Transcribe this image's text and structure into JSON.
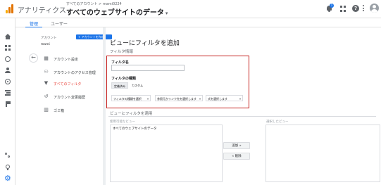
{
  "header": {
    "product": "アナリティクス",
    "breadcrumb": "すべてのアカウント > mami0224",
    "view_title": "すべてのウェブサイトのデータ",
    "notification_count": "1"
  },
  "admin_tabs": [
    {
      "label": "管理"
    },
    {
      "label": "ユーザー"
    }
  ],
  "account_column": {
    "label": "アカウント",
    "create_button": "+ アカウントを作成",
    "account_name": "mami",
    "menu": [
      {
        "label": "アカウント設定",
        "icon": "building-icon"
      },
      {
        "label": "アカウントのアクセス管理",
        "icon": "people-icon"
      },
      {
        "label": "すべてのフィルタ",
        "icon": "filter-icon",
        "active": true
      },
      {
        "label": "アカウント変更履歴",
        "icon": "history-icon"
      },
      {
        "label": "ゴミ箱",
        "icon": "trash-icon"
      }
    ]
  },
  "main": {
    "title": "ビューにフィルタを追加",
    "filter_info_heading": "フィルタ情報",
    "filter_name_label": "フィルタ名",
    "filter_name_value": "",
    "filter_type_label": "フィルタの種類",
    "type_buttons": [
      {
        "label": "定義済み"
      },
      {
        "label": "カスタム"
      }
    ],
    "selects": [
      {
        "label": "フィルタの種類を選択"
      },
      {
        "label": "参照元かリンク先を選択します"
      },
      {
        "label": "式を選択します"
      }
    ],
    "apply_heading": "ビューにフィルタを適用",
    "available_views_label": "使用可能なビュー",
    "selected_views_label": "選択したビュー",
    "available_views": [
      "すべてのウェブサイトのデータ"
    ],
    "add_button": "追加 »",
    "remove_button": "« 削除"
  },
  "colors": {
    "accent": "#1a73e8",
    "highlight_border": "#c5221f",
    "active_menu_text": "#e8453c"
  }
}
